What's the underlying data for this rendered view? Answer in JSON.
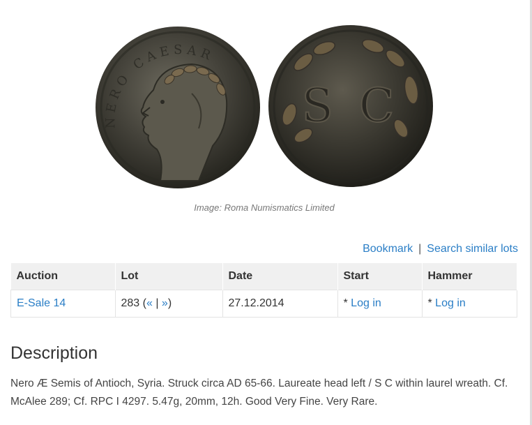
{
  "image": {
    "caption": "Image: Roma Numismatics Limited",
    "obverse_legend": "NERO CAESAR",
    "reverse_inscription": "S C"
  },
  "actions": {
    "bookmark": "Bookmark",
    "separator": "|",
    "search_similar": "Search similar lots"
  },
  "table": {
    "headers": [
      "Auction",
      "Lot",
      "Date",
      "Start",
      "Hammer"
    ],
    "row": {
      "auction": "E-Sale 14",
      "lot_number": "283 (",
      "prev": "«",
      "lot_sep": " | ",
      "next": "»",
      "lot_close": ")",
      "date": "27.12.2014",
      "start_prefix": "* ",
      "start_link": "Log in",
      "hammer_prefix": "* ",
      "hammer_link": "Log in"
    }
  },
  "description": {
    "title": "Description",
    "text": "Nero Æ Semis of Antioch, Syria. Struck circa AD 65-66. Laureate head left / S C within laurel wreath. Cf. McAlee 289; Cf. RPC I 4297. 5.47g, 20mm, 12h. Good Very Fine. Very Rare."
  }
}
